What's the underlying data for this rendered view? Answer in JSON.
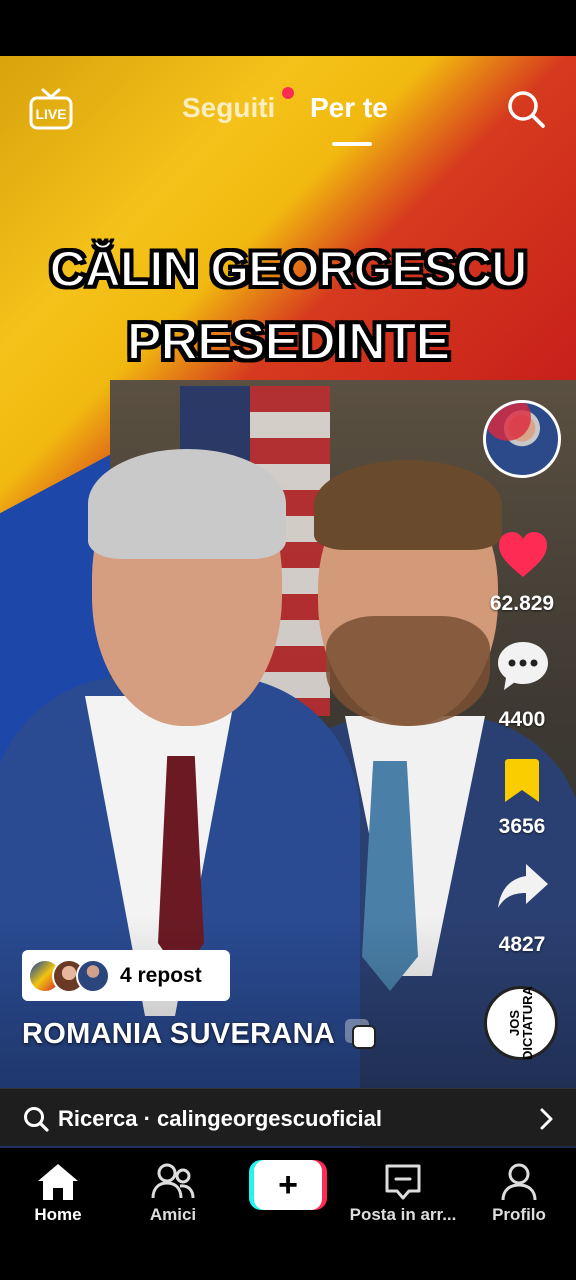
{
  "top_nav": {
    "live_label": "LIVE",
    "tabs": [
      {
        "label": "Seguiti",
        "has_dot": true
      },
      {
        "label": "Per te",
        "active": true
      }
    ]
  },
  "video": {
    "headline_line1": "CĂLIN GEORGESCU",
    "headline_line2": "PRESEDINTE",
    "caption": "ROMANIA SUVERANA",
    "repost_label": "4 repost"
  },
  "actions": {
    "likes": "62.829",
    "comments": "4400",
    "bookmarks": "3656",
    "shares": "4827",
    "sound_disc_text": "JOS DICTATURA"
  },
  "search_suggestion": {
    "text": "Ricerca · calingeorgescuoficial"
  },
  "bottom_nav": {
    "items": [
      {
        "label": "Home",
        "icon": "home-icon",
        "active": true
      },
      {
        "label": "Amici",
        "icon": "friends-icon"
      },
      {
        "label": "",
        "icon": "plus-icon"
      },
      {
        "label": "Posta in arr...",
        "icon": "inbox-icon"
      },
      {
        "label": "Profilo",
        "icon": "profile-icon"
      }
    ]
  },
  "colors": {
    "like_red": "#fe2c55",
    "bookmark_yellow": "#facd00",
    "create_cyan": "#25f4ee",
    "create_pink": "#fe2c55"
  }
}
